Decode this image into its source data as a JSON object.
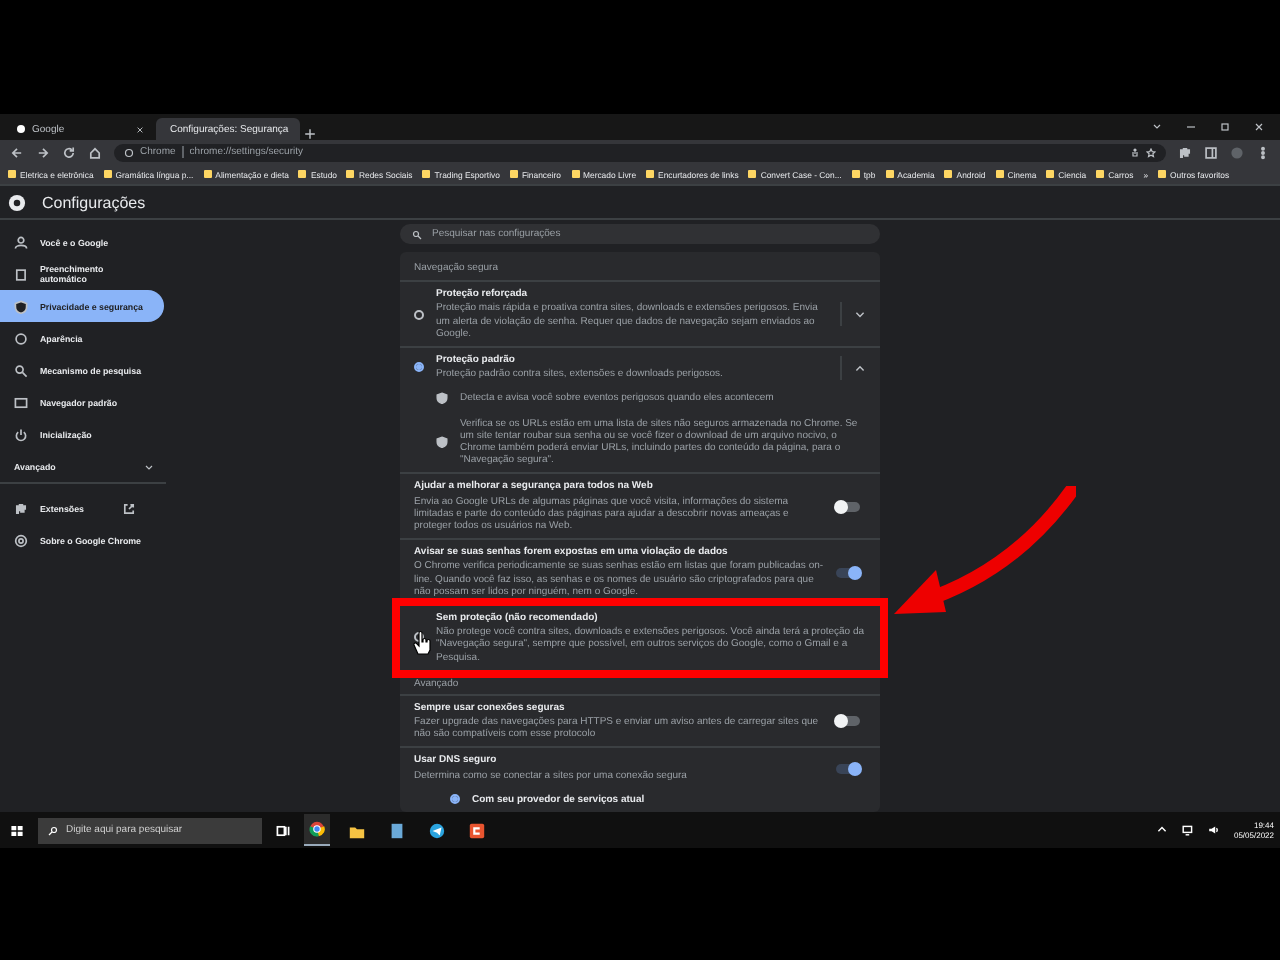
{
  "browser": {
    "tabs": [
      {
        "title": "Google",
        "selected": false
      },
      {
        "title": "Configurações: Segurança",
        "selected": true
      }
    ],
    "address": {
      "origin": "Chrome",
      "url": "chrome://settings/security"
    },
    "bookmarks": [
      "Eletrica e eletrônica",
      "Gramática língua p...",
      "Alimentação e dieta",
      "Estudo",
      "Redes Sociais",
      "Trading Esportivo",
      "Financeiro",
      "Mercado Livre",
      "Encurtadores de links",
      "Convert Case - Con...",
      "tpb",
      "Academia",
      "Android",
      "Cinema",
      "Ciencia",
      "Carros"
    ],
    "bookmarks_more": "»",
    "other_bookmarks": "Outros favoritos"
  },
  "settings": {
    "title": "Configurações",
    "search": {
      "placeholder": "Pesquisar nas configurações"
    },
    "sidebar": {
      "items": [
        {
          "label": "Você e o Google",
          "selected": false
        },
        {
          "label": "Preenchimento automático",
          "selected": false
        },
        {
          "label": "Privacidade e segurança",
          "selected": true
        },
        {
          "label": "Aparência",
          "selected": false
        },
        {
          "label": "Mecanismo de pesquisa",
          "selected": false
        },
        {
          "label": "Navegador padrão",
          "selected": false
        },
        {
          "label": "Inicialização",
          "selected": false
        }
      ],
      "advanced": {
        "label": "Avançado",
        "expanded": false
      },
      "more_items": [
        {
          "label": "Extensões",
          "selected": false
        },
        {
          "label": "Sobre o Google Chrome",
          "selected": false
        }
      ]
    },
    "section_title": "Navegação segura",
    "rows": [
      {
        "kind": "radio",
        "title": "Proteção reforçada",
        "description": "Proteção mais rápida e proativa contra sites, downloads e extensões perigosos. Envia um alerta de violação de senha. Requer que dados de navegação sejam enviados ao Google.",
        "selected": false,
        "expanded": false
      },
      {
        "kind": "radio",
        "title": "Proteção padrão",
        "description": "Proteção padrão contra sites, extensões e downloads perigosos.",
        "selected": true,
        "expanded": true
      },
      {
        "kind": "bullet",
        "text": "Detecta e avisa você sobre eventos perigosos quando eles acontecem"
      },
      {
        "kind": "bullet",
        "text": "Verifica se os URLs estão em uma lista de sites não seguros armazenada no Chrome. Se um site tentar roubar sua senha ou se você fizer o download de um arquivo nocivo, o Chrome também poderá enviar URLs, incluindo partes do conteúdo da página, para o \"Navegação segura\"."
      },
      {
        "kind": "toggle",
        "title": "Ajudar a melhorar a segurança para todos na Web",
        "description": "Envia ao Google URLs de algumas páginas que você visita, informações do sistema limitadas e parte do conteúdo das páginas para ajudar a descobrir novas ameaças e proteger todos os usuários na Web.",
        "on": false
      },
      {
        "kind": "toggle",
        "title": "Avisar se suas senhas forem expostas em uma violação de dados",
        "description": "O Chrome verifica periodicamente se suas senhas estão em listas que foram publicadas on-line. Quando você faz isso, as senhas e os nomes de usuário são criptografados para que não possam ser lidos por ninguém, nem o Google.",
        "on": true
      },
      {
        "kind": "radio",
        "title": "Sem proteção (não recomendado)",
        "description": "Não protege você contra sites, downloads e extensões perigosos. Você ainda terá a proteção da \"Navegação segura\", sempre que possível, em outros serviços do Google, como o Gmail e a Pesquisa.",
        "selected": false,
        "highlighted": true
      }
    ],
    "advanced_title": "Avançado",
    "advanced_rows": [
      {
        "kind": "toggle",
        "title": "Sempre usar conexões seguras",
        "description": "Fazer upgrade das navegações para HTTPS e enviar um aviso antes de carregar sites que não são compatíveis com esse protocolo",
        "on": false
      },
      {
        "kind": "toggle",
        "title": "Usar DNS seguro",
        "description": "Determina como se conectar a sites por uma conexão segura",
        "on": true
      },
      {
        "kind": "subradio",
        "title": "Com seu provedor de serviços atual",
        "selected": true
      }
    ]
  },
  "taskbar": {
    "search": {
      "placeholder": "Digite aqui para pesquisar"
    },
    "time": "19:44",
    "date": "05/05/2022"
  }
}
